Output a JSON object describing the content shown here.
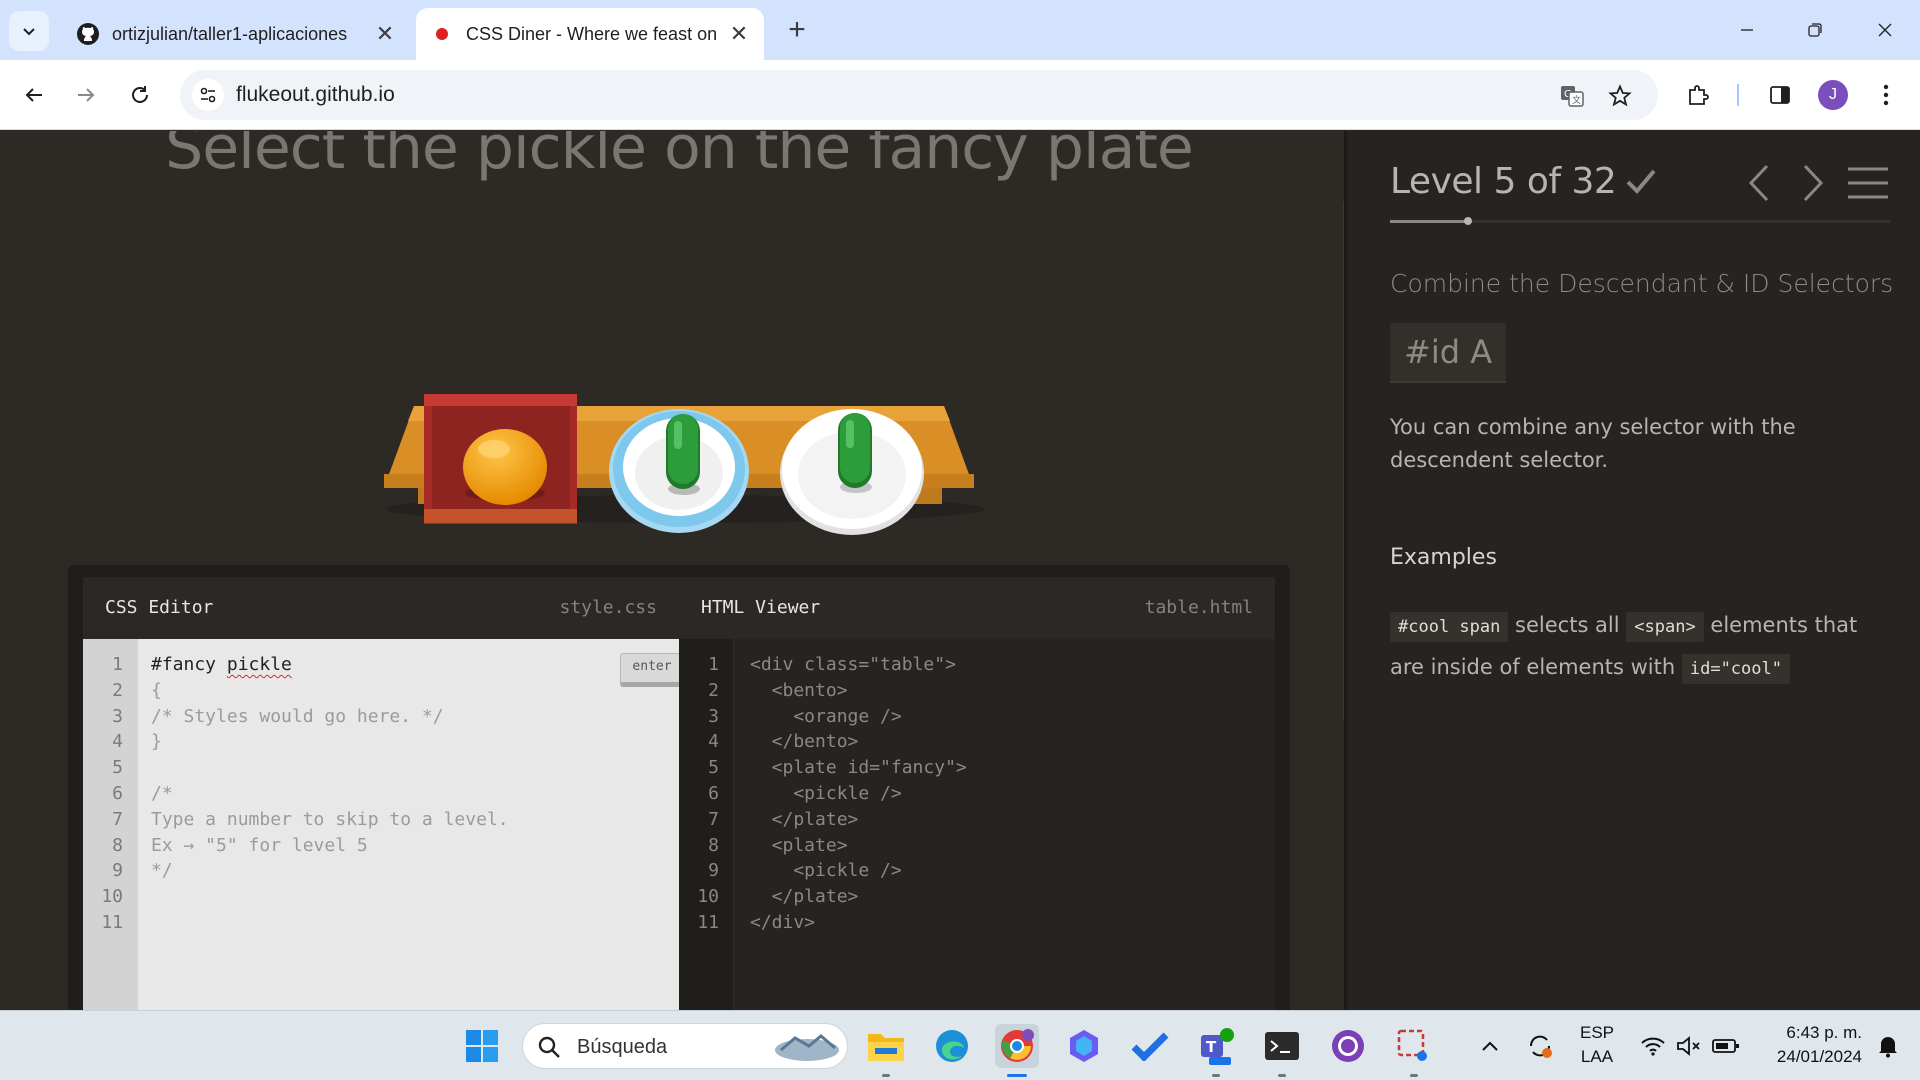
{
  "browser": {
    "tabs": [
      {
        "title": "ortizjulian/taller1-aplicaciones",
        "active": false
      },
      {
        "title": "CSS Diner - Where we feast on CSS Selectors!",
        "active": true
      }
    ],
    "url": "flukeout.github.io",
    "profile_initial": "J"
  },
  "game": {
    "order_text": "Select the pickle on the fancy plate",
    "table_items": [
      "bento with orange",
      "fancy plate with pickle",
      "plate with pickle"
    ],
    "css_editor": {
      "title": "CSS Editor",
      "file": "style.css",
      "enter_label": "enter",
      "line_numbers": [
        "1",
        "2",
        "3",
        "4",
        "5",
        "6",
        "7",
        "8",
        "9",
        "10",
        "11"
      ],
      "lines": [
        "#fancy pickle",
        "{",
        "/* Styles would go here. */",
        "}",
        "",
        "/*",
        "Type a number to skip to a level.",
        "Ex → \"5\" for level 5",
        "*/",
        "",
        ""
      ]
    },
    "html_viewer": {
      "title": "HTML Viewer",
      "file": "table.html",
      "line_numbers": [
        "1",
        "2",
        "3",
        "4",
        "5",
        "6",
        "7",
        "8",
        "9",
        "10",
        "11"
      ],
      "lines": [
        "<div class=\"table\">",
        "  <bento>",
        "    <orange />",
        "  </bento>",
        "  <plate id=\"fancy\">",
        "    <pickle />",
        "  </plate>",
        "  <plate>",
        "    <pickle />",
        "  </plate>",
        "</div>"
      ]
    }
  },
  "sidebar": {
    "level_title": "Level 5 of 32",
    "level_progress": 0.156,
    "selector_name": "Combine the Descendant & ID Selectors",
    "syntax": "#id  A",
    "hint": "You can combine any selector with the descendent selector.",
    "examples_heading": "Examples",
    "example": {
      "code1": "#cool span",
      "text1": "selects all",
      "code2": "<span>",
      "text2": "elements that are inside of elements with",
      "code3": "id=\"cool\""
    }
  },
  "taskbar": {
    "search_placeholder": "Búsqueda",
    "language": "ESP",
    "layout": "LAA",
    "time": "6:43 p. m.",
    "date": "24/01/2024"
  },
  "colors": {
    "page_bg": "#2d2a26",
    "table_wood": "#e59e33",
    "bento_red": "#a62b26",
    "orange": "#f5a00a",
    "pickle_green": "#2d9c3a",
    "fancy_plate_rim": "#8fd0f0"
  }
}
